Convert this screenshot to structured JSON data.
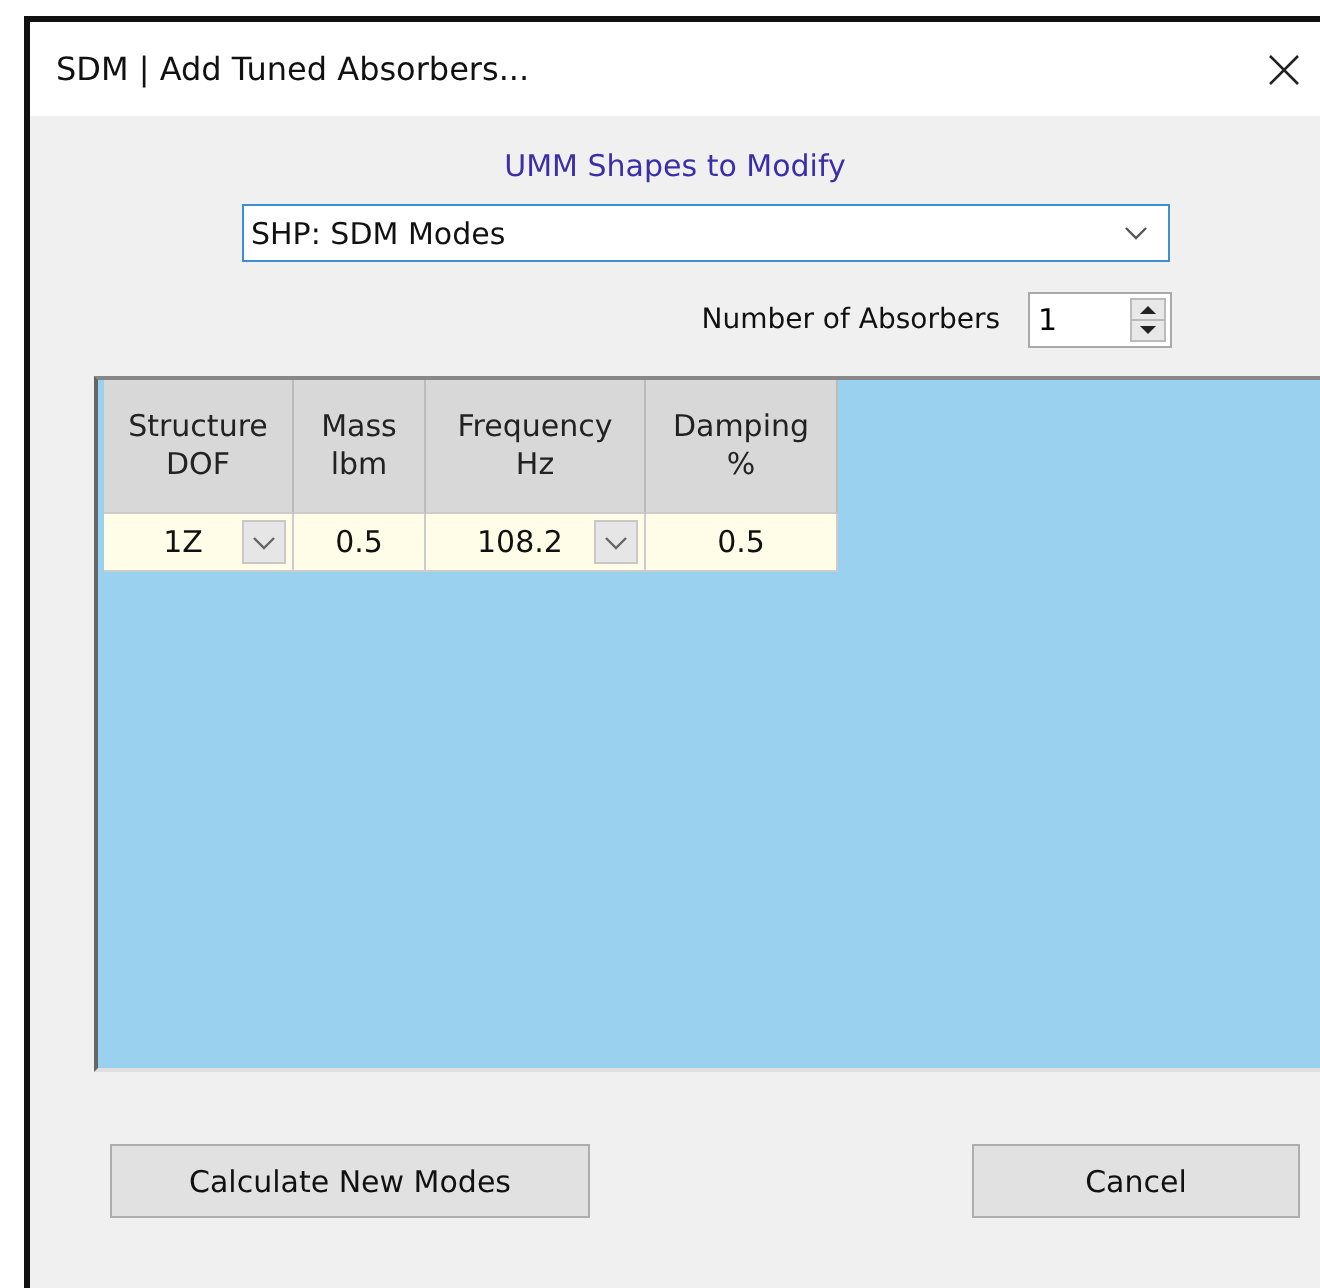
{
  "window": {
    "title": "SDM | Add Tuned Absorbers..."
  },
  "shapes": {
    "label": "UMM Shapes to Modify",
    "value": "SHP: SDM Modes"
  },
  "absorbers": {
    "label": "Number of Absorbers",
    "value": "1"
  },
  "table": {
    "columns": [
      {
        "lines": [
          "Structure",
          "DOF"
        ]
      },
      {
        "lines": [
          "Mass",
          "lbm"
        ]
      },
      {
        "lines": [
          "Frequency",
          "Hz"
        ]
      },
      {
        "lines": [
          "Damping",
          "%"
        ]
      }
    ],
    "rows": [
      [
        {
          "kind": "dropdown",
          "text": "1Z"
        },
        {
          "kind": "text",
          "text": "0.5"
        },
        {
          "kind": "dropdown",
          "text": "108.2"
        },
        {
          "kind": "text",
          "text": "0.5"
        }
      ]
    ]
  },
  "buttons": [
    "Calculate New Modes",
    "Cancel"
  ]
}
